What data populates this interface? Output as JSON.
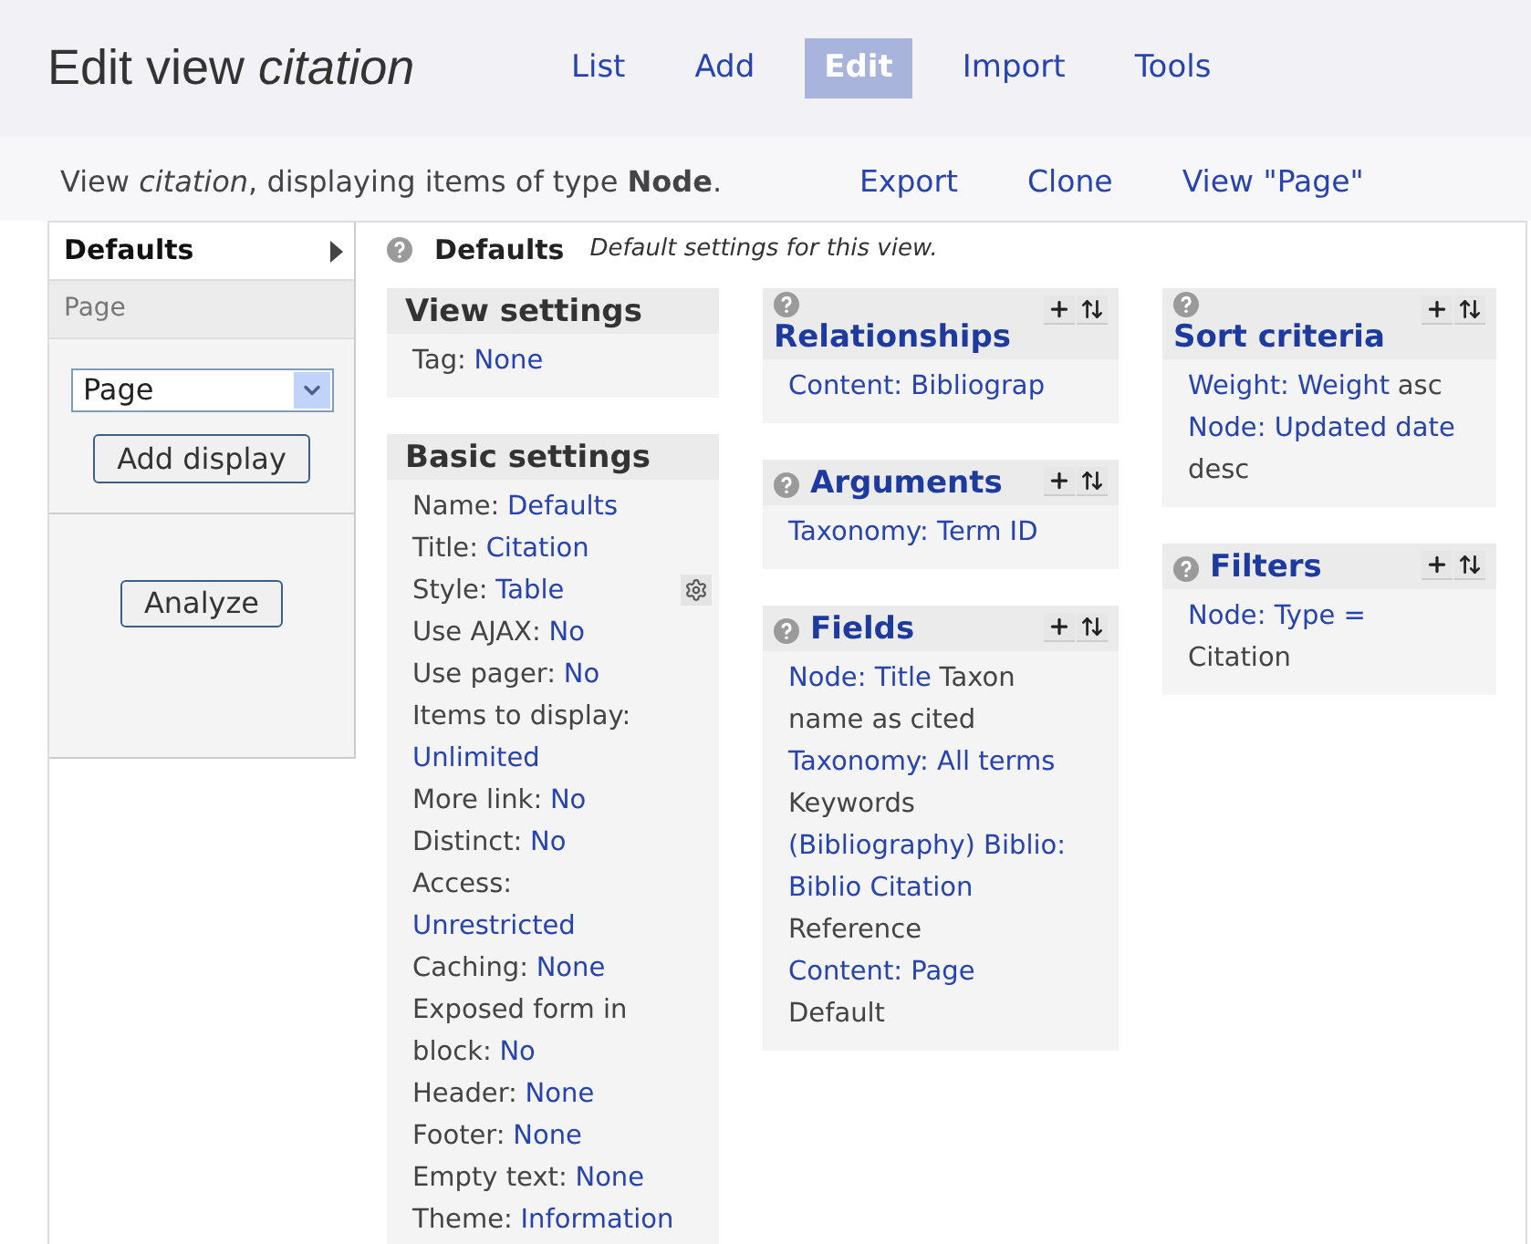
{
  "header": {
    "title": "Edit view *citation*",
    "tabs": [
      {
        "label": "List",
        "selected": false
      },
      {
        "label": "Add",
        "selected": false
      },
      {
        "label": "Edit",
        "selected": true
      },
      {
        "label": "Import",
        "selected": false
      },
      {
        "label": "Tools",
        "selected": false
      }
    ]
  },
  "subheader": {
    "description": "View *citation*, displaying items of type **Node**.",
    "links": [
      "Export",
      "Clone",
      "View \"Page\""
    ]
  },
  "sidebar": {
    "displays": [
      {
        "label": "Defaults",
        "selected": true
      },
      {
        "label": "Page",
        "selected": false
      }
    ],
    "select": {
      "value": "Page"
    },
    "add_button": "Add display",
    "analyze_button": "Analyze"
  },
  "main": {
    "title": "Defaults",
    "description": "Default settings for this view.",
    "columns": [
      [
        {
          "title": "View settings",
          "kind": "plain",
          "lines": [
            {
              "parts": [
                {
                  "text": "Tag:",
                  "link": false
                },
                {
                  "text": "None",
                  "link": true
                }
              ]
            }
          ]
        },
        {
          "title": "Basic settings",
          "kind": "plain",
          "lines": [
            {
              "kind": "plain",
              "parts": [
                {
                  "text": "Name:",
                  "link": false
                },
                {
                  "text": "Defaults",
                  "link": true
                }
              ]
            },
            {
              "kind": "plain",
              "parts": [
                {
                  "text": "Title:",
                  "link": false
                },
                {
                  "text": "Citation",
                  "link": true
                }
              ]
            },
            {
              "kind": "configurable",
              "parts": [
                {
                  "text": "Style:",
                  "link": false
                },
                {
                  "text": "Table",
                  "link": true
                }
              ]
            },
            {
              "kind": "plain",
              "parts": [
                {
                  "text": "Use AJAX:",
                  "link": false
                },
                {
                  "text": "No",
                  "link": true
                }
              ]
            },
            {
              "kind": "plain",
              "parts": [
                {
                  "text": "Use pager:",
                  "link": false
                },
                {
                  "text": "No",
                  "link": true
                }
              ]
            },
            {
              "kind": "plain",
              "parts": [
                {
                  "text": "Items to display:",
                  "link": false
                }
              ]
            },
            {
              "kind": "plain",
              "parts": [
                {
                  "text": "Unlimited",
                  "link": true
                }
              ]
            },
            {
              "kind": "plain",
              "parts": [
                {
                  "text": "More link:",
                  "link": false
                },
                {
                  "text": "No",
                  "link": true
                }
              ]
            },
            {
              "kind": "plain",
              "parts": [
                {
                  "text": "Distinct:",
                  "link": false
                },
                {
                  "text": "No",
                  "link": true
                }
              ]
            },
            {
              "kind": "plain",
              "parts": [
                {
                  "text": "Access:",
                  "link": false
                }
              ]
            },
            {
              "kind": "plain",
              "parts": [
                {
                  "text": "Unrestricted",
                  "link": true
                }
              ]
            },
            {
              "kind": "plain",
              "parts": [
                {
                  "text": "Caching:",
                  "link": false
                },
                {
                  "text": "None",
                  "link": true
                }
              ]
            },
            {
              "kind": "plain",
              "parts": [
                {
                  "text": "Exposed form in",
                  "link": false
                }
              ]
            },
            {
              "kind": "plain",
              "parts": [
                {
                  "text": "block:",
                  "link": false
                },
                {
                  "text": "No",
                  "link": true
                }
              ]
            },
            {
              "kind": "plain",
              "parts": [
                {
                  "text": "Header:",
                  "link": false
                },
                {
                  "text": "None",
                  "link": true
                }
              ]
            },
            {
              "kind": "plain",
              "parts": [
                {
                  "text": "Footer:",
                  "link": false
                },
                {
                  "text": "None",
                  "link": true
                }
              ]
            },
            {
              "kind": "plain",
              "parts": [
                {
                  "text": "Empty text:",
                  "link": false
                },
                {
                  "text": "None",
                  "link": true
                }
              ]
            },
            {
              "kind": "plain",
              "parts": [
                {
                  "text": "Theme:",
                  "link": false
                },
                {
                  "text": "Information",
                  "link": true
                }
              ]
            }
          ]
        }
      ],
      [
        {
          "title": "Relationships",
          "kind": "linked",
          "lines": [
            {
              "parts": [
                {
                  "text": "Content: Bibliograp",
                  "link": true
                }
              ]
            }
          ]
        },
        {
          "title": "Arguments",
          "kind": "linked",
          "lines": [
            {
              "parts": [
                {
                  "text": "Taxonomy: Term ID",
                  "link": true
                }
              ]
            }
          ]
        },
        {
          "title": "Fields",
          "kind": "linked",
          "lines": [
            {
              "parts": [
                {
                  "text": "Node: Title",
                  "link": true
                },
                {
                  "text": "Taxon",
                  "link": false
                }
              ]
            },
            {
              "parts": [
                {
                  "text": "name as cited",
                  "link": false
                }
              ]
            },
            {
              "parts": [
                {
                  "text": "Taxonomy: All terms",
                  "link": true
                }
              ]
            },
            {
              "parts": [
                {
                  "text": "Keywords",
                  "link": false
                }
              ]
            },
            {
              "parts": [
                {
                  "text": "(Bibliography) Biblio:",
                  "link": true
                }
              ]
            },
            {
              "parts": [
                {
                  "text": "Biblio Citation",
                  "link": true
                }
              ]
            },
            {
              "parts": [
                {
                  "text": "Reference",
                  "link": false
                }
              ]
            },
            {
              "parts": [
                {
                  "text": "Content: Page",
                  "link": true
                }
              ]
            },
            {
              "parts": [
                {
                  "text": "Default",
                  "link": false
                }
              ]
            }
          ]
        }
      ],
      [
        {
          "title": "Sort criteria",
          "kind": "linked",
          "lines": [
            {
              "parts": [
                {
                  "text": "Weight: Weight",
                  "link": true
                },
                {
                  "text": "asc",
                  "link": false
                }
              ]
            },
            {
              "parts": [
                {
                  "text": "Node: Updated date",
                  "link": true
                }
              ]
            },
            {
              "parts": [
                {
                  "text": "desc",
                  "link": false
                }
              ]
            }
          ]
        },
        {
          "title": "Filters",
          "kind": "linked",
          "lines": [
            {
              "parts": [
                {
                  "text": "Node: Type =",
                  "link": true
                }
              ]
            },
            {
              "parts": [
                {
                  "text": "Citation",
                  "link": false
                }
              ]
            }
          ]
        }
      ]
    ]
  }
}
